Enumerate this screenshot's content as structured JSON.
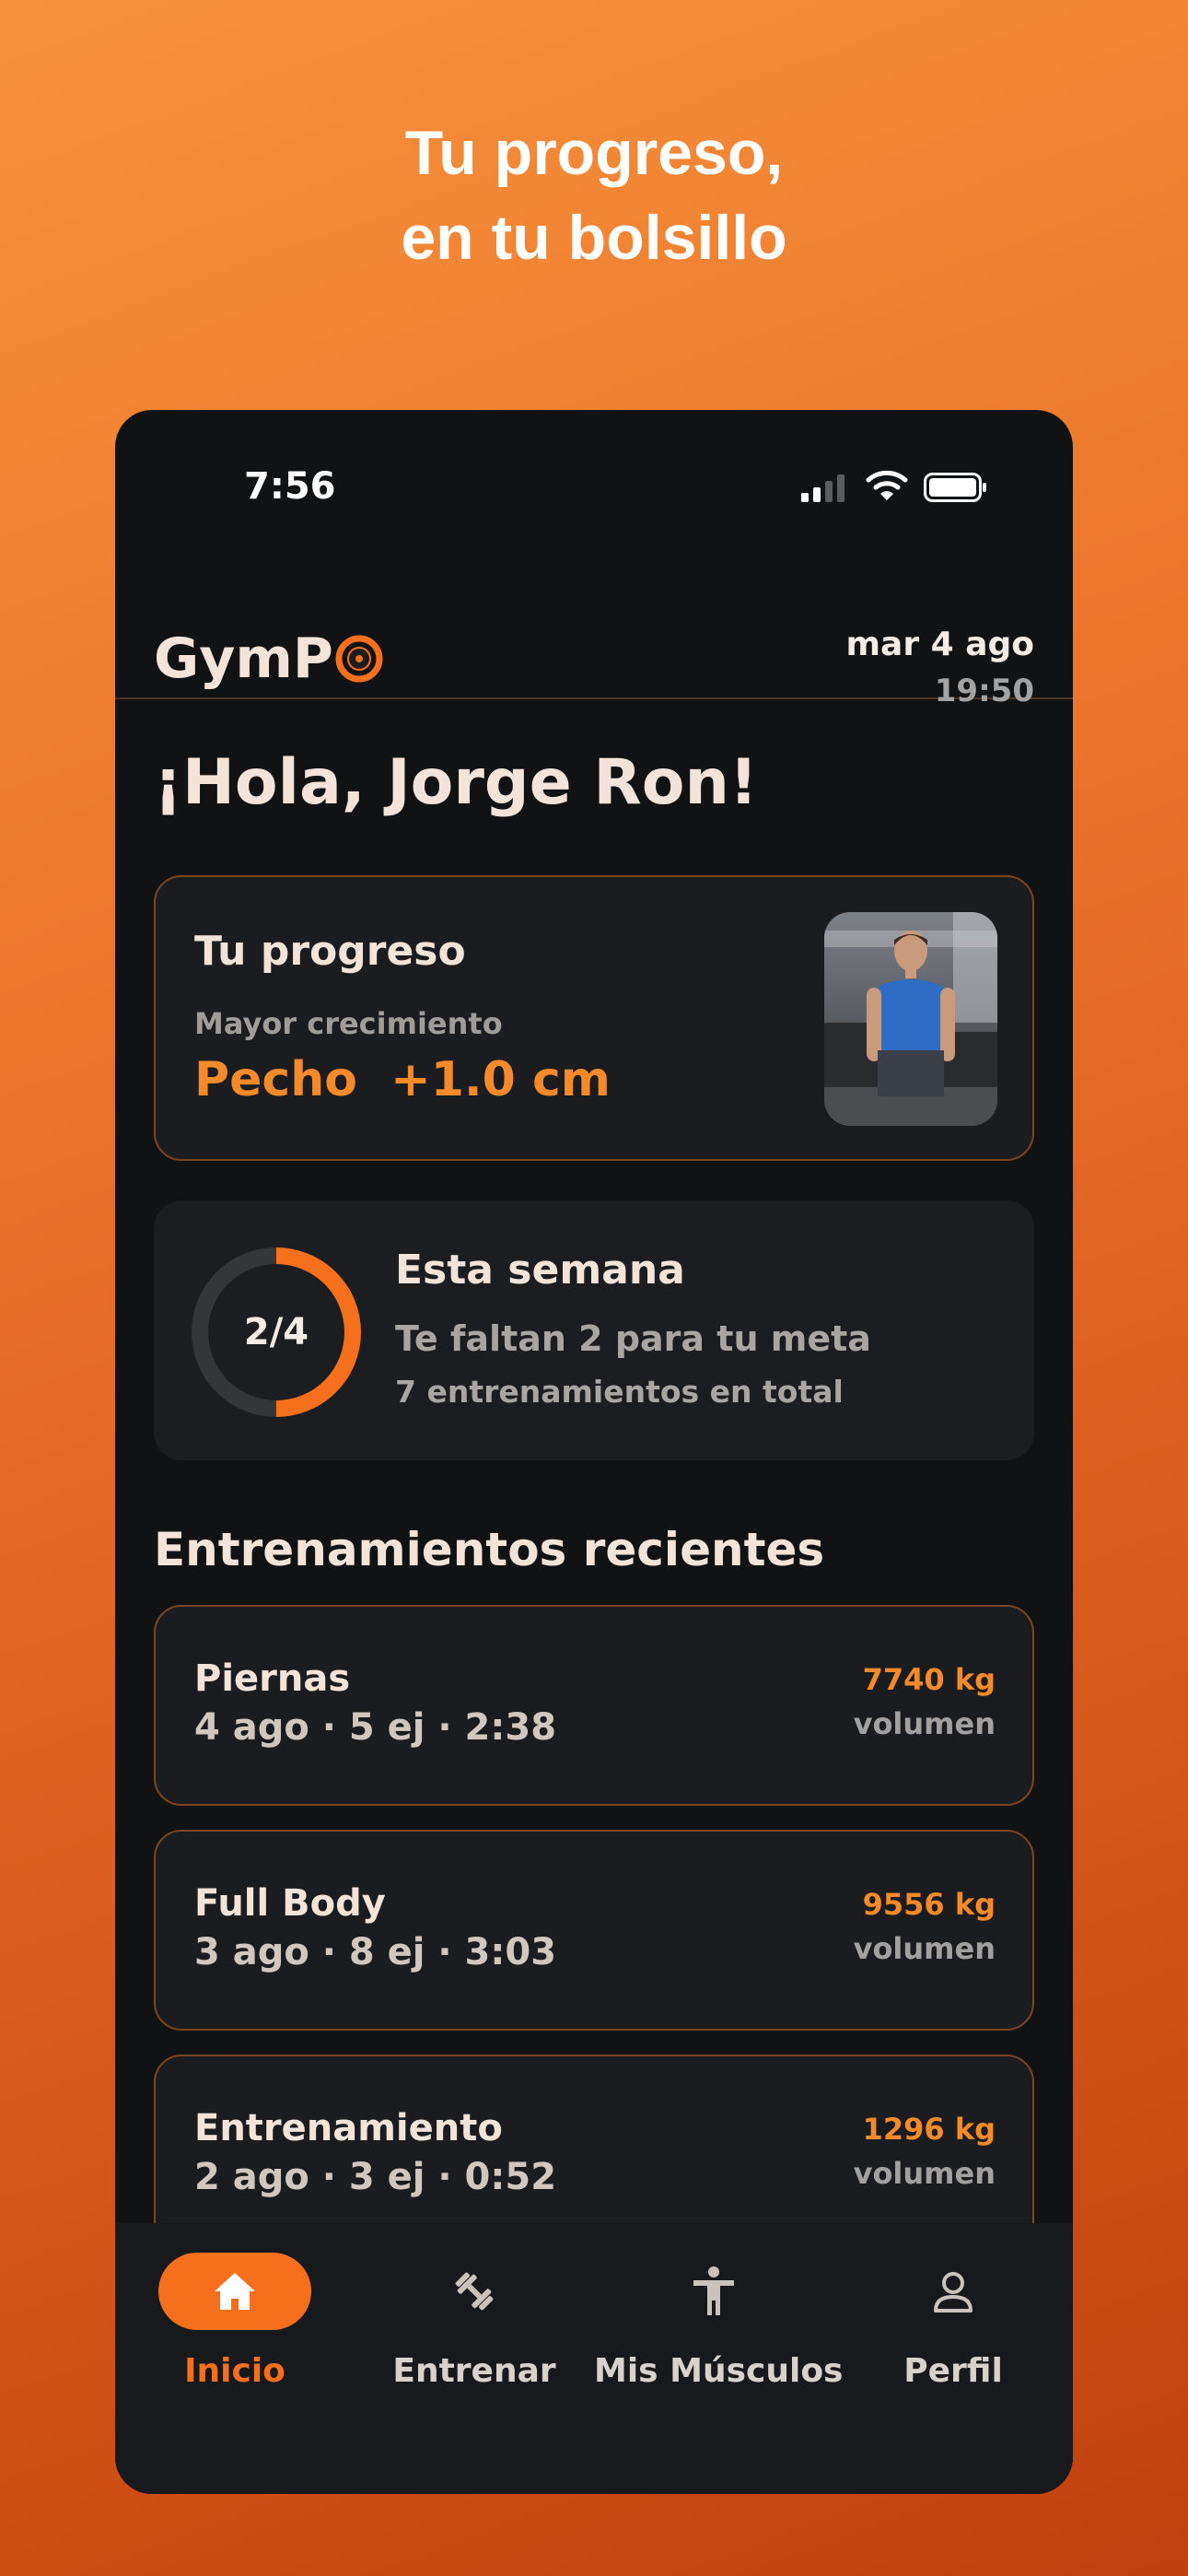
{
  "headline": {
    "line1": "Tu progreso,",
    "line2": "en tu bolsillo"
  },
  "status_bar": {
    "time": "7:56"
  },
  "app": {
    "logo_text": "GymP",
    "date": "mar 4 ago",
    "clock": "19:50"
  },
  "greeting": "¡Hola, Jorge Ron!",
  "progress_card": {
    "title": "Tu progreso",
    "subtitle": "Mayor crecimiento",
    "value": "Pecho  +1.0 cm"
  },
  "week_card": {
    "ring_label": "2/4",
    "ring_fraction": 0.5,
    "title": "Esta semana",
    "subtitle": "Te faltan 2 para tu meta",
    "total": "7 entrenamientos en total"
  },
  "recent": {
    "title": "Entrenamientos recientes",
    "workouts": [
      {
        "name": "Piernas",
        "meta": "4 ago · 5 ej · 2:38",
        "volume": "7740 kg",
        "volume_label": "volumen"
      },
      {
        "name": "Full Body",
        "meta": "3 ago · 8 ej · 3:03",
        "volume": "9556 kg",
        "volume_label": "volumen"
      },
      {
        "name": "Entrenamiento",
        "meta": "2 ago · 3 ej · 0:52",
        "volume": "1296 kg",
        "volume_label": "volumen"
      }
    ]
  },
  "tabs": [
    {
      "label": "Inicio",
      "icon": "home-icon",
      "active": true
    },
    {
      "label": "Entrenar",
      "icon": "dumbbell-icon",
      "active": false
    },
    {
      "label": "Mis Músculos",
      "icon": "body-icon",
      "active": false
    },
    {
      "label": "Perfil",
      "icon": "user-icon",
      "active": false
    }
  ],
  "colors": {
    "accent": "#f56f1c",
    "card_border": "#7a4620",
    "background": "#111214"
  }
}
